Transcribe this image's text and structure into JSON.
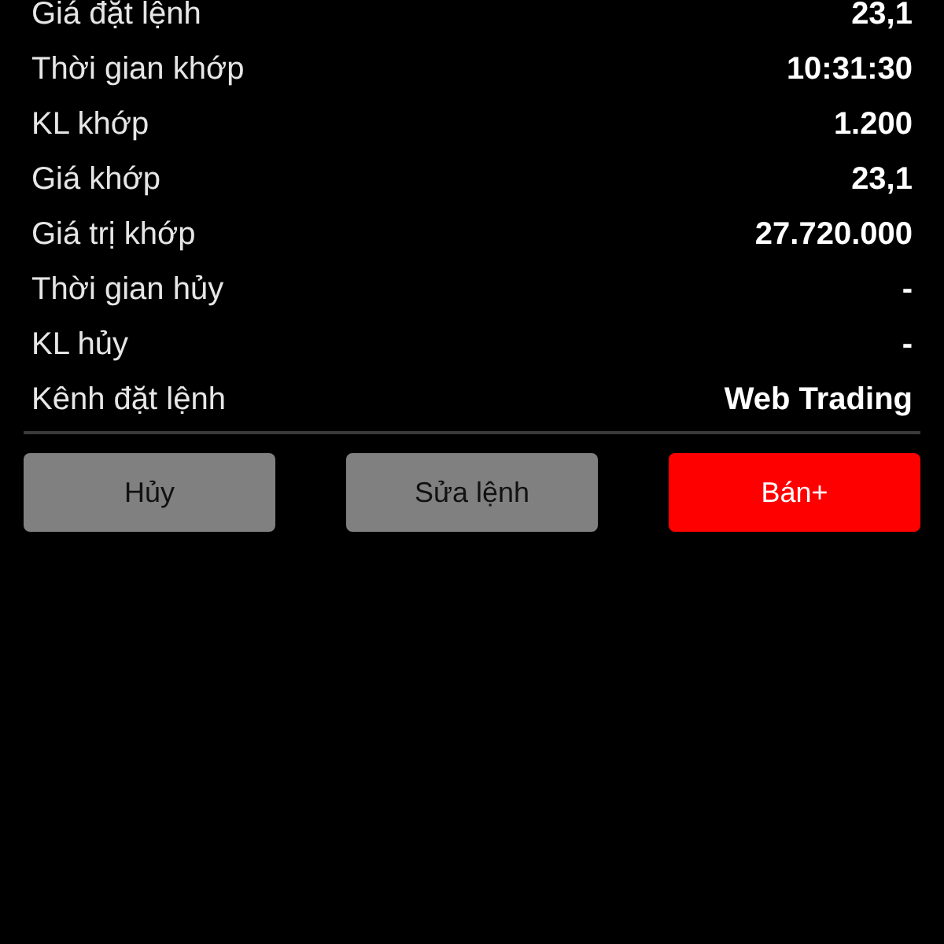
{
  "details": [
    {
      "label": "Giá đặt lệnh",
      "value": "23,1"
    },
    {
      "label": "Thời gian khớp",
      "value": "10:31:30"
    },
    {
      "label": "KL khớp",
      "value": "1.200"
    },
    {
      "label": "Giá khớp",
      "value": "23,1"
    },
    {
      "label": "Giá trị khớp",
      "value": "27.720.000"
    },
    {
      "label": "Thời gian hủy",
      "value": "-"
    },
    {
      "label": "KL hủy",
      "value": "-"
    },
    {
      "label": "Kênh đặt lệnh",
      "value": "Web Trading"
    }
  ],
  "buttons": [
    {
      "label": "Hủy",
      "kind": "neutral"
    },
    {
      "label": "Sửa lệnh",
      "kind": "neutral"
    },
    {
      "label": "Bán+",
      "kind": "sell"
    }
  ]
}
